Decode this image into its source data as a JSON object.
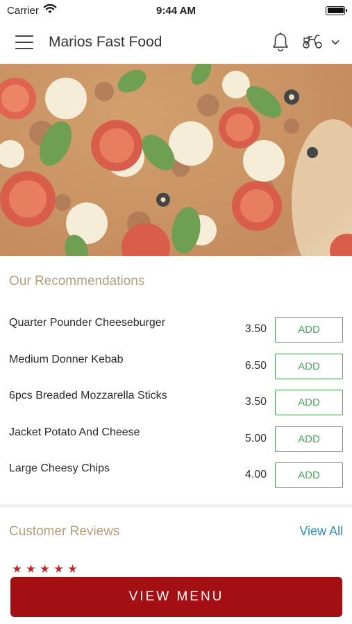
{
  "status_bar": {
    "carrier": "Carrier",
    "time": "9:44 AM"
  },
  "header": {
    "title": "Marios Fast Food",
    "icons": [
      "menu-icon",
      "bell-icon",
      "scooter-icon",
      "chevron-down-icon"
    ]
  },
  "recommendations": {
    "title": "Our Recommendations",
    "items": [
      {
        "name": "Quarter Pounder Cheeseburger",
        "price": "3.50",
        "button": "ADD"
      },
      {
        "name": "Medium Donner Kebab",
        "price": "6.50",
        "button": "ADD"
      },
      {
        "name": "6pcs Breaded Mozzarella Sticks",
        "price": "3.50",
        "button": "ADD"
      },
      {
        "name": "Jacket Potato And Cheese",
        "price": "5.00",
        "button": "ADD"
      },
      {
        "name": "Large Cheesy Chips",
        "price": "4.00",
        "button": "ADD"
      }
    ]
  },
  "reviews": {
    "title": "Customer Reviews",
    "view_all": "View All",
    "peek_rating": 5
  },
  "footer": {
    "view_menu": "VIEW MENU"
  },
  "colors": {
    "accent_red": "#a30f12",
    "add_green": "#4ea35c",
    "section_title": "#b39f7a",
    "link_blue": "#2d8fc3"
  }
}
